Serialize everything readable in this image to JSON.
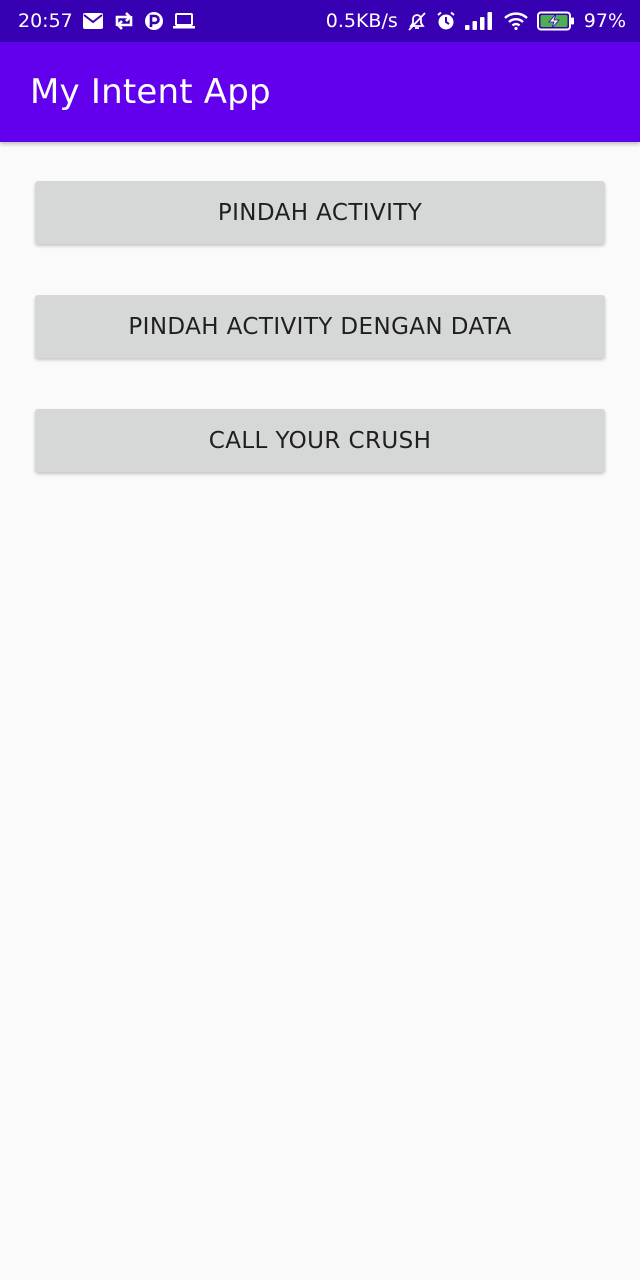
{
  "status_bar": {
    "time": "20:57",
    "net_speed": "0.5KB/s",
    "battery": "97%",
    "icons": [
      "mail-icon",
      "sync-icon",
      "p-app-icon",
      "laptop-icon",
      "mute-icon",
      "alarm-icon",
      "signal-icon",
      "wifi-icon",
      "battery-icon"
    ]
  },
  "app_bar": {
    "title": "My Intent App",
    "color": "#6200ee"
  },
  "buttons": [
    {
      "label": "PINDAH ACTIVITY"
    },
    {
      "label": "PINDAH ACTIVITY DENGAN DATA"
    },
    {
      "label": "CALL YOUR CRUSH"
    }
  ],
  "colors": {
    "status_bar": "#3700b3",
    "background": "#fafafa",
    "button": "#d6d7d7"
  }
}
